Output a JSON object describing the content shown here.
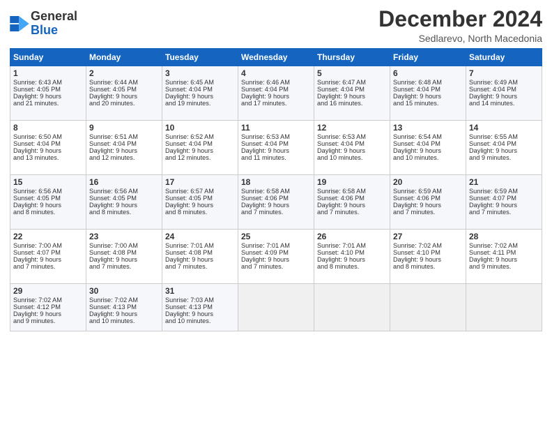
{
  "header": {
    "logo_line1": "General",
    "logo_line2": "Blue",
    "month": "December 2024",
    "location": "Sedlarevo, North Macedonia"
  },
  "days_of_week": [
    "Sunday",
    "Monday",
    "Tuesday",
    "Wednesday",
    "Thursday",
    "Friday",
    "Saturday"
  ],
  "weeks": [
    [
      {
        "day": "1",
        "lines": [
          "Sunrise: 6:43 AM",
          "Sunset: 4:05 PM",
          "Daylight: 9 hours",
          "and 21 minutes."
        ]
      },
      {
        "day": "2",
        "lines": [
          "Sunrise: 6:44 AM",
          "Sunset: 4:05 PM",
          "Daylight: 9 hours",
          "and 20 minutes."
        ]
      },
      {
        "day": "3",
        "lines": [
          "Sunrise: 6:45 AM",
          "Sunset: 4:04 PM",
          "Daylight: 9 hours",
          "and 19 minutes."
        ]
      },
      {
        "day": "4",
        "lines": [
          "Sunrise: 6:46 AM",
          "Sunset: 4:04 PM",
          "Daylight: 9 hours",
          "and 17 minutes."
        ]
      },
      {
        "day": "5",
        "lines": [
          "Sunrise: 6:47 AM",
          "Sunset: 4:04 PM",
          "Daylight: 9 hours",
          "and 16 minutes."
        ]
      },
      {
        "day": "6",
        "lines": [
          "Sunrise: 6:48 AM",
          "Sunset: 4:04 PM",
          "Daylight: 9 hours",
          "and 15 minutes."
        ]
      },
      {
        "day": "7",
        "lines": [
          "Sunrise: 6:49 AM",
          "Sunset: 4:04 PM",
          "Daylight: 9 hours",
          "and 14 minutes."
        ]
      }
    ],
    [
      {
        "day": "8",
        "lines": [
          "Sunrise: 6:50 AM",
          "Sunset: 4:04 PM",
          "Daylight: 9 hours",
          "and 13 minutes."
        ]
      },
      {
        "day": "9",
        "lines": [
          "Sunrise: 6:51 AM",
          "Sunset: 4:04 PM",
          "Daylight: 9 hours",
          "and 12 minutes."
        ]
      },
      {
        "day": "10",
        "lines": [
          "Sunrise: 6:52 AM",
          "Sunset: 4:04 PM",
          "Daylight: 9 hours",
          "and 12 minutes."
        ]
      },
      {
        "day": "11",
        "lines": [
          "Sunrise: 6:53 AM",
          "Sunset: 4:04 PM",
          "Daylight: 9 hours",
          "and 11 minutes."
        ]
      },
      {
        "day": "12",
        "lines": [
          "Sunrise: 6:53 AM",
          "Sunset: 4:04 PM",
          "Daylight: 9 hours",
          "and 10 minutes."
        ]
      },
      {
        "day": "13",
        "lines": [
          "Sunrise: 6:54 AM",
          "Sunset: 4:04 PM",
          "Daylight: 9 hours",
          "and 10 minutes."
        ]
      },
      {
        "day": "14",
        "lines": [
          "Sunrise: 6:55 AM",
          "Sunset: 4:04 PM",
          "Daylight: 9 hours",
          "and 9 minutes."
        ]
      }
    ],
    [
      {
        "day": "15",
        "lines": [
          "Sunrise: 6:56 AM",
          "Sunset: 4:05 PM",
          "Daylight: 9 hours",
          "and 8 minutes."
        ]
      },
      {
        "day": "16",
        "lines": [
          "Sunrise: 6:56 AM",
          "Sunset: 4:05 PM",
          "Daylight: 9 hours",
          "and 8 minutes."
        ]
      },
      {
        "day": "17",
        "lines": [
          "Sunrise: 6:57 AM",
          "Sunset: 4:05 PM",
          "Daylight: 9 hours",
          "and 8 minutes."
        ]
      },
      {
        "day": "18",
        "lines": [
          "Sunrise: 6:58 AM",
          "Sunset: 4:06 PM",
          "Daylight: 9 hours",
          "and 7 minutes."
        ]
      },
      {
        "day": "19",
        "lines": [
          "Sunrise: 6:58 AM",
          "Sunset: 4:06 PM",
          "Daylight: 9 hours",
          "and 7 minutes."
        ]
      },
      {
        "day": "20",
        "lines": [
          "Sunrise: 6:59 AM",
          "Sunset: 4:06 PM",
          "Daylight: 9 hours",
          "and 7 minutes."
        ]
      },
      {
        "day": "21",
        "lines": [
          "Sunrise: 6:59 AM",
          "Sunset: 4:07 PM",
          "Daylight: 9 hours",
          "and 7 minutes."
        ]
      }
    ],
    [
      {
        "day": "22",
        "lines": [
          "Sunrise: 7:00 AM",
          "Sunset: 4:07 PM",
          "Daylight: 9 hours",
          "and 7 minutes."
        ]
      },
      {
        "day": "23",
        "lines": [
          "Sunrise: 7:00 AM",
          "Sunset: 4:08 PM",
          "Daylight: 9 hours",
          "and 7 minutes."
        ]
      },
      {
        "day": "24",
        "lines": [
          "Sunrise: 7:01 AM",
          "Sunset: 4:08 PM",
          "Daylight: 9 hours",
          "and 7 minutes."
        ]
      },
      {
        "day": "25",
        "lines": [
          "Sunrise: 7:01 AM",
          "Sunset: 4:09 PM",
          "Daylight: 9 hours",
          "and 7 minutes."
        ]
      },
      {
        "day": "26",
        "lines": [
          "Sunrise: 7:01 AM",
          "Sunset: 4:10 PM",
          "Daylight: 9 hours",
          "and 8 minutes."
        ]
      },
      {
        "day": "27",
        "lines": [
          "Sunrise: 7:02 AM",
          "Sunset: 4:10 PM",
          "Daylight: 9 hours",
          "and 8 minutes."
        ]
      },
      {
        "day": "28",
        "lines": [
          "Sunrise: 7:02 AM",
          "Sunset: 4:11 PM",
          "Daylight: 9 hours",
          "and 9 minutes."
        ]
      }
    ],
    [
      {
        "day": "29",
        "lines": [
          "Sunrise: 7:02 AM",
          "Sunset: 4:12 PM",
          "Daylight: 9 hours",
          "and 9 minutes."
        ]
      },
      {
        "day": "30",
        "lines": [
          "Sunrise: 7:02 AM",
          "Sunset: 4:13 PM",
          "Daylight: 9 hours",
          "and 10 minutes."
        ]
      },
      {
        "day": "31",
        "lines": [
          "Sunrise: 7:03 AM",
          "Sunset: 4:13 PM",
          "Daylight: 9 hours",
          "and 10 minutes."
        ]
      },
      {
        "day": "",
        "lines": []
      },
      {
        "day": "",
        "lines": []
      },
      {
        "day": "",
        "lines": []
      },
      {
        "day": "",
        "lines": []
      }
    ]
  ]
}
